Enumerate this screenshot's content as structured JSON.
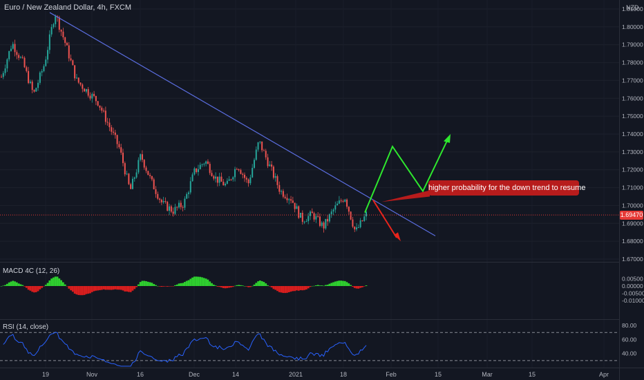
{
  "header": {
    "title": "Euro / New Zealand Dollar, 4h, FXCM",
    "currency": "NZD"
  },
  "callout": {
    "text": "higher probability for the down trend to resume"
  },
  "price_axis": {
    "labels": [
      "1.81000",
      "1.80000",
      "1.79000",
      "1.78000",
      "1.77000",
      "1.76000",
      "1.75000",
      "1.74000",
      "1.73000",
      "1.72000",
      "1.71000",
      "1.70000",
      "1.69000",
      "1.68000",
      "1.67000"
    ],
    "current_price": "1.69470"
  },
  "time_axis": {
    "labels": [
      "19",
      "Nov",
      "16",
      "Dec",
      "14",
      "2021",
      "18",
      "Feb",
      "15",
      "Mar",
      "15",
      "Apr"
    ]
  },
  "macd": {
    "label": "MACD 4C (12, 26)",
    "axis_labels": [
      "0.00500",
      "0.00000",
      "-0.00500",
      "-0.01000"
    ]
  },
  "rsi": {
    "label": "RSI (14, close)",
    "axis_labels": [
      "80.00",
      "60.00",
      "40.00"
    ]
  },
  "colors": {
    "background": "#131722",
    "up": "#26a69a",
    "down": "#ef5350",
    "trendline": "#5b6ee1",
    "projection_up": "#2ee82e",
    "projection_down": "#e8241c",
    "macd_up": "#2fcf2f",
    "macd_down": "#d81e1e",
    "rsi_line": "#2962ff",
    "price_tag": "#e53935"
  },
  "chart_data": {
    "type": "candlestick",
    "title": "Euro / New Zealand Dollar, 4h, FXCM",
    "close_path": [
      [
        "19",
        1.772
      ],
      [
        "19",
        1.791
      ],
      [
        "19",
        1.78
      ],
      [
        "19",
        1.762
      ],
      [
        "Nov",
        1.779
      ],
      [
        "Nov",
        1.808
      ],
      [
        "Nov",
        1.79
      ],
      [
        "Nov",
        1.77
      ],
      [
        "Nov",
        1.764
      ],
      [
        "Nov",
        1.758
      ],
      [
        "Nov",
        1.745
      ],
      [
        "Nov",
        1.732
      ],
      [
        "16",
        1.708
      ],
      [
        "16",
        1.728
      ],
      [
        "16",
        1.713
      ],
      [
        "16",
        1.701
      ],
      [
        "Dec",
        1.697
      ],
      [
        "Dec",
        1.701
      ],
      [
        "Dec",
        1.719
      ],
      [
        "Dec",
        1.725
      ],
      [
        "Dec",
        1.715
      ],
      [
        "Dec",
        1.711
      ],
      [
        "14",
        1.723
      ],
      [
        "14",
        1.712
      ],
      [
        "14",
        1.736
      ],
      [
        "14",
        1.722
      ],
      [
        "14",
        1.708
      ],
      [
        "2021",
        1.704
      ],
      [
        "2021",
        1.692
      ],
      [
        "2021",
        1.695
      ],
      [
        "2021",
        1.688
      ],
      [
        "18",
        1.698
      ],
      [
        "18",
        1.705
      ],
      [
        "18",
        1.685
      ],
      [
        "18",
        1.695
      ]
    ],
    "last_price": 1.6947,
    "ylim": [
      1.67,
      1.815
    ],
    "annotations": {
      "trendline": [
        [
          1.808
        ],
        [
          1.683
        ]
      ],
      "projection_up": [
        1.696,
        1.733,
        1.708,
        1.74
      ],
      "projection_down": [
        1.703,
        1.68
      ],
      "callout": "higher probability for the down trend to resume"
    },
    "indicators": {
      "macd": {
        "name": "MACD 4C (12, 26)",
        "ylim": [
          -0.011,
          0.0065
        ]
      },
      "rsi": {
        "name": "RSI (14, close)",
        "levels": [
          70,
          30
        ],
        "ylim": [
          20,
          85
        ]
      }
    }
  }
}
